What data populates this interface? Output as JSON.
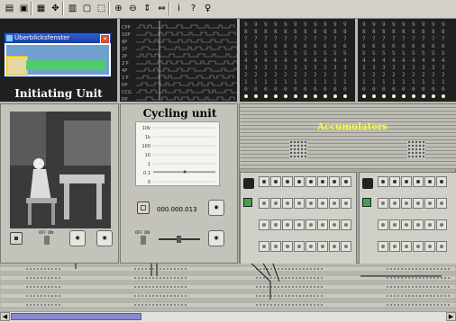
{
  "toolbar": {
    "buttons": [
      {
        "name": "open-icon",
        "glyph": "▤"
      },
      {
        "name": "save-icon",
        "glyph": "▣"
      },
      {
        "name": "grid-icon",
        "glyph": "▦"
      },
      {
        "name": "move-icon",
        "glyph": "✥"
      },
      {
        "name": "library-icon",
        "glyph": "▥"
      },
      {
        "name": "copy-icon",
        "glyph": "▢"
      },
      {
        "name": "pointer-icon",
        "glyph": "⬚"
      },
      {
        "name": "zoom-in-icon",
        "glyph": "⊕"
      },
      {
        "name": "zoom-out-icon",
        "glyph": "⊖"
      },
      {
        "name": "fit-height-icon",
        "glyph": "⇕"
      },
      {
        "name": "fit-width-icon",
        "glyph": "⇔"
      },
      {
        "name": "info-icon",
        "glyph": "ⅰ"
      },
      {
        "name": "help-icon",
        "glyph": "?"
      },
      {
        "name": "bulb-icon",
        "glyph": "♀"
      }
    ]
  },
  "overview_window": {
    "title": "Überblicksfenster",
    "close": "×"
  },
  "panels": {
    "initiating_unit": {
      "title": "Initiating Unit"
    },
    "cycling_unit": {
      "title": "Cycling unit",
      "counter": "000.000.013"
    },
    "accumulators": {
      "title": "Accumulators"
    }
  },
  "cycling_chart": {
    "ticks": [
      "10k",
      "1k",
      "100",
      "10",
      "1",
      "0.1",
      "0"
    ]
  },
  "digit_columns": [
    "9",
    "8",
    "7",
    "6",
    "5",
    "4",
    "3",
    "2",
    "1",
    "0"
  ],
  "scope_labels": [
    "CPP",
    "10P",
    "9P",
    "1P",
    "2P",
    "2'P",
    "4P",
    "1'P",
    "RP",
    "CCG",
    "RP"
  ],
  "switch_labels": {
    "off": "OFF",
    "on": "ON"
  },
  "colors": {
    "accent_yellow": "#ffff33",
    "bg_gray": "#c3c3bb",
    "dark": "#1f1f1f"
  }
}
